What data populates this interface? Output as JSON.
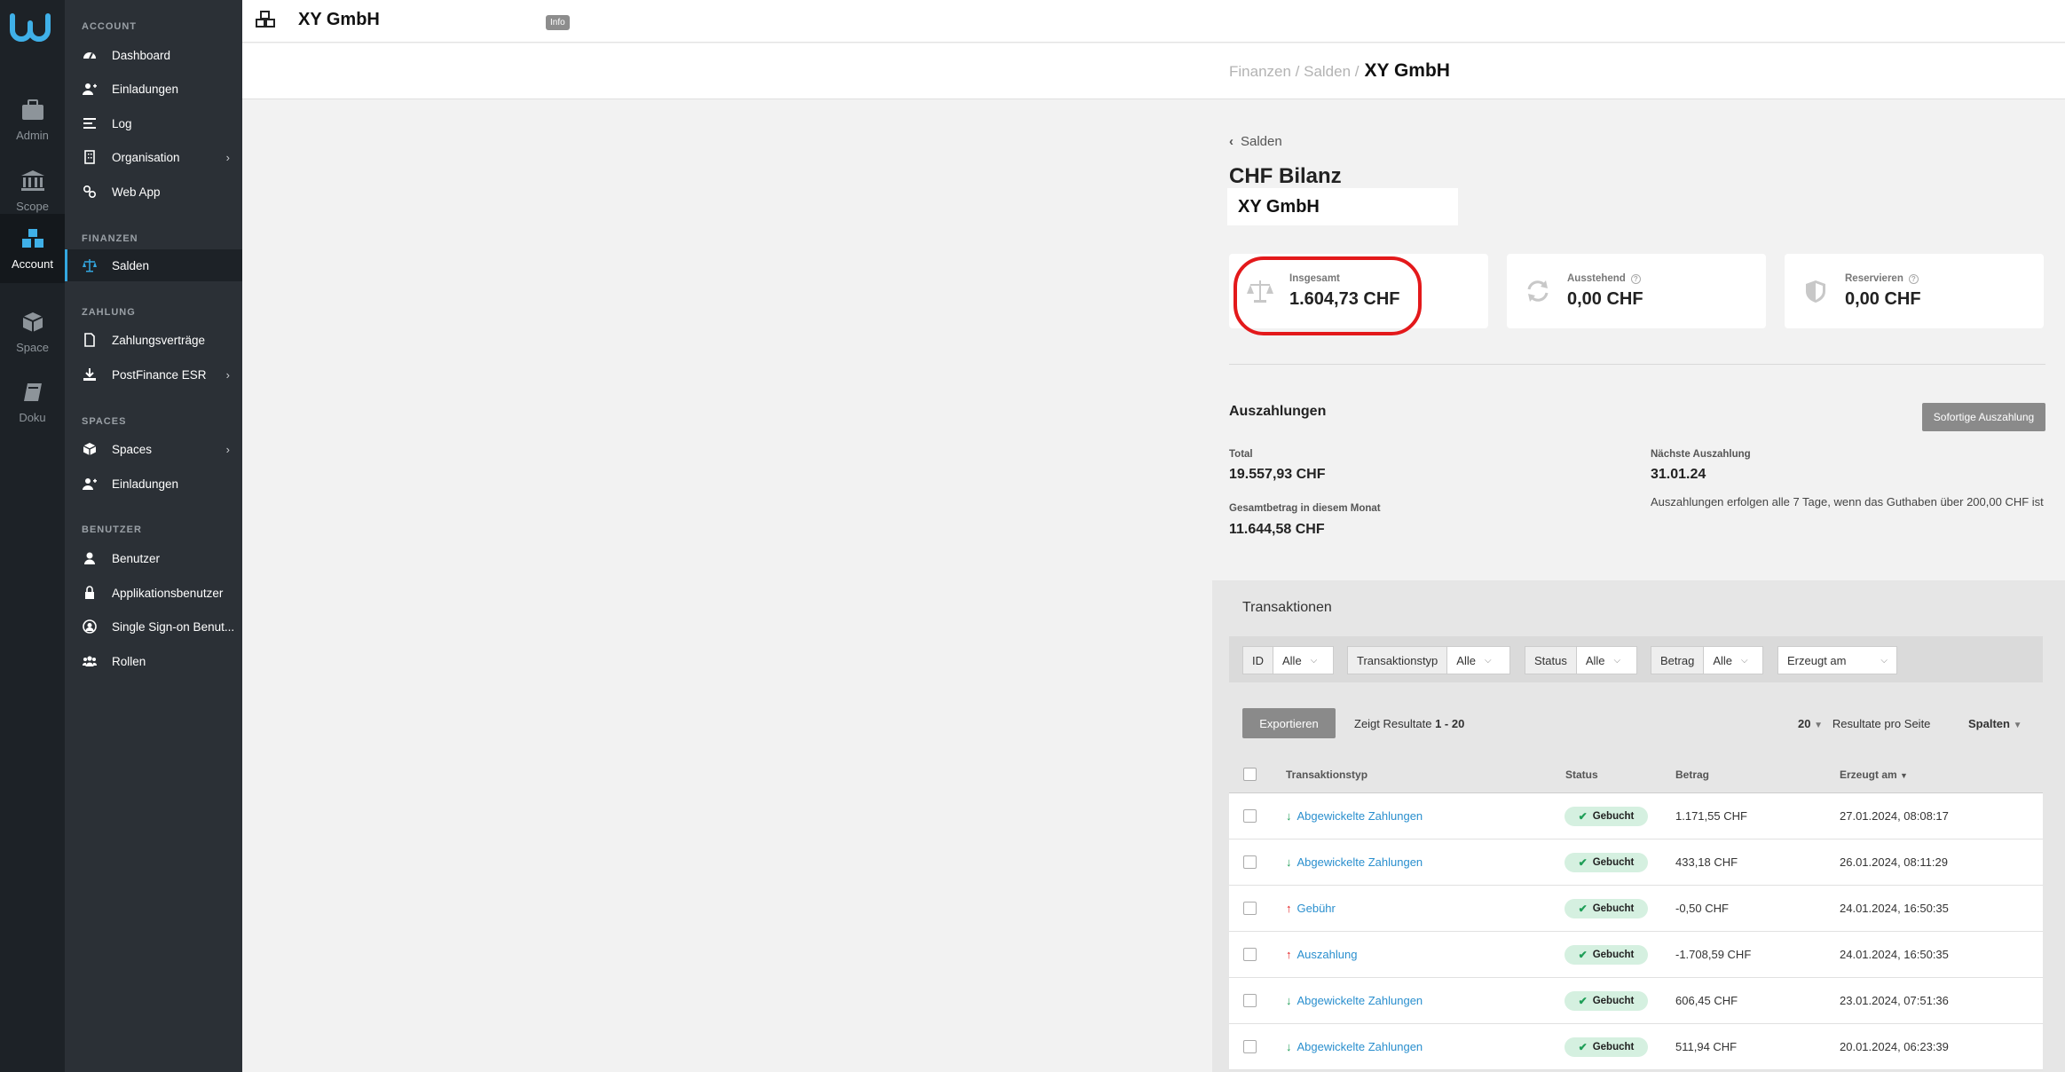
{
  "rail": {
    "items": [
      {
        "label": "Admin"
      },
      {
        "label": "Scope"
      },
      {
        "label": "Account"
      },
      {
        "label": "Space"
      },
      {
        "label": "Doku"
      }
    ]
  },
  "sidebar": {
    "sections": [
      {
        "title": "ACCOUNT",
        "items": [
          "Dashboard",
          "Einladungen",
          "Log",
          "Organisation",
          "Web App"
        ]
      },
      {
        "title": "FINANZEN",
        "items": [
          "Salden"
        ]
      },
      {
        "title": "ZAHLUNG",
        "items": [
          "Zahlungsverträge",
          "PostFinance ESR"
        ]
      },
      {
        "title": "SPACES",
        "items": [
          "Spaces",
          "Einladungen"
        ]
      },
      {
        "title": "BENUTZER",
        "items": [
          "Benutzer",
          "Applikationsbenutzer",
          "Single Sign-on Benut...",
          "Rollen"
        ]
      }
    ]
  },
  "topbar": {
    "org_name": "XY GmbH",
    "info_badge": "Info"
  },
  "breadcrumb": {
    "path": "Finanzen / Salden /",
    "current": "XY GmbH"
  },
  "page": {
    "back_label": "Salden",
    "title": "CHF Bilanz",
    "org": "XY GmbH"
  },
  "cards": [
    {
      "label": "Insgesamt",
      "value": "1.604,73 CHF",
      "icon": "scale-icon"
    },
    {
      "label": "Ausstehend",
      "value": "0,00 CHF",
      "icon": "refresh-icon"
    },
    {
      "label": "Reservieren",
      "value": "0,00 CHF",
      "icon": "shield-icon"
    }
  ],
  "payouts": {
    "title": "Auszahlungen",
    "button": "Sofortige Auszahlung",
    "total_label": "Total",
    "total_value": "19.557,93 CHF",
    "month_label": "Gesamtbetrag in diesem Monat",
    "month_value": "11.644,58 CHF",
    "next_label": "Nächste Auszahlung",
    "next_value": "31.01.24",
    "note": "Auszahlungen erfolgen alle 7 Tage, wenn das Guthaben über 200,00 CHF ist"
  },
  "transactions": {
    "title": "Transaktionen",
    "filters": [
      {
        "label": "ID",
        "value": "Alle"
      },
      {
        "label": "Transaktionstyp",
        "value": "Alle"
      },
      {
        "label": "Status",
        "value": "Alle"
      },
      {
        "label": "Betrag",
        "value": "Alle"
      },
      {
        "label": "Erzeugt am",
        "value": ""
      }
    ],
    "export_button": "Exportieren",
    "results_prefix": "Zeigt Resultate",
    "results_range": "1 - 20",
    "per_page_value": "20",
    "per_page_label": "Resultate pro Seite",
    "columns_label": "Spalten",
    "headers": [
      "Transaktionstyp",
      "Status",
      "Betrag",
      "Erzeugt am"
    ],
    "rows": [
      {
        "type": "Abgewickelte Zahlungen",
        "dir": "in",
        "status": "Gebucht",
        "amount": "1.171,55 CHF",
        "date": "27.01.2024, 08:08:17"
      },
      {
        "type": "Abgewickelte Zahlungen",
        "dir": "in",
        "status": "Gebucht",
        "amount": "433,18 CHF",
        "date": "26.01.2024, 08:11:29"
      },
      {
        "type": "Gebühr",
        "dir": "out",
        "status": "Gebucht",
        "amount": "-0,50 CHF",
        "date": "24.01.2024, 16:50:35"
      },
      {
        "type": "Auszahlung",
        "dir": "out",
        "status": "Gebucht",
        "amount": "-1.708,59 CHF",
        "date": "24.01.2024, 16:50:35"
      },
      {
        "type": "Abgewickelte Zahlungen",
        "dir": "in",
        "status": "Gebucht",
        "amount": "606,45 CHF",
        "date": "23.01.2024, 07:51:36"
      },
      {
        "type": "Abgewickelte Zahlungen",
        "dir": "in",
        "status": "Gebucht",
        "amount": "511,94 CHF",
        "date": "20.01.2024, 06:23:39"
      }
    ]
  },
  "colors": {
    "accent": "#2a8fce",
    "highlight": "#e3191b",
    "status_bg": "#d5f0e0"
  }
}
